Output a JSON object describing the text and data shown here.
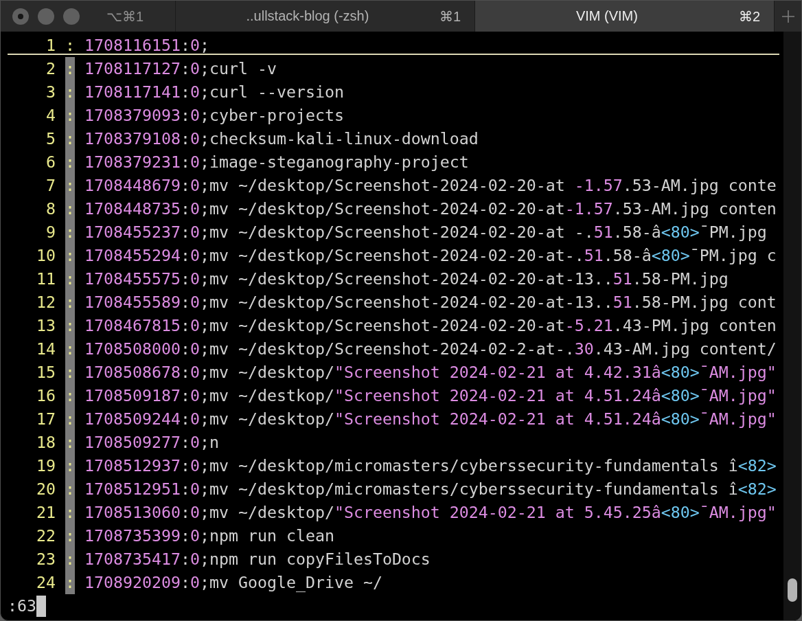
{
  "window": {
    "shortcut": "⌥⌘1"
  },
  "tabs": [
    {
      "title": "..ullstack-blog (-zsh)",
      "shortcut": "⌘1",
      "selected": false
    },
    {
      "title": "VIM (VIM)",
      "shortcut": "⌘2",
      "selected": true
    }
  ],
  "editor": {
    "lines": [
      {
        "number": "1",
        "prefix": ":",
        "highlighted": false,
        "cursorline": true,
        "segments": [
          {
            "kind": "constant",
            "text": "1708116151"
          },
          {
            "kind": "plain",
            "text": ":"
          },
          {
            "kind": "constant",
            "text": "0"
          },
          {
            "kind": "plain",
            "text": ";"
          }
        ]
      },
      {
        "number": "2",
        "prefix": ":",
        "highlighted": true,
        "cursorline": false,
        "segments": [
          {
            "kind": "constant",
            "text": "1708117127"
          },
          {
            "kind": "plain",
            "text": ":"
          },
          {
            "kind": "constant",
            "text": "0"
          },
          {
            "kind": "plain",
            "text": ";curl -v"
          }
        ]
      },
      {
        "number": "3",
        "prefix": ":",
        "highlighted": true,
        "cursorline": false,
        "segments": [
          {
            "kind": "constant",
            "text": "1708117141"
          },
          {
            "kind": "plain",
            "text": ":"
          },
          {
            "kind": "constant",
            "text": "0"
          },
          {
            "kind": "plain",
            "text": ";curl --version"
          }
        ]
      },
      {
        "number": "4",
        "prefix": ":",
        "highlighted": true,
        "cursorline": false,
        "segments": [
          {
            "kind": "constant",
            "text": "1708379093"
          },
          {
            "kind": "plain",
            "text": ":"
          },
          {
            "kind": "constant",
            "text": "0"
          },
          {
            "kind": "plain",
            "text": ";cyber-projects"
          }
        ]
      },
      {
        "number": "5",
        "prefix": ":",
        "highlighted": true,
        "cursorline": false,
        "segments": [
          {
            "kind": "constant",
            "text": "1708379108"
          },
          {
            "kind": "plain",
            "text": ":"
          },
          {
            "kind": "constant",
            "text": "0"
          },
          {
            "kind": "plain",
            "text": ";checksum-kali-linux-download"
          }
        ]
      },
      {
        "number": "6",
        "prefix": ":",
        "highlighted": true,
        "cursorline": false,
        "segments": [
          {
            "kind": "constant",
            "text": "1708379231"
          },
          {
            "kind": "plain",
            "text": ":"
          },
          {
            "kind": "constant",
            "text": "0"
          },
          {
            "kind": "plain",
            "text": ";image-steganography-project"
          }
        ]
      },
      {
        "number": "7",
        "prefix": ":",
        "highlighted": true,
        "cursorline": false,
        "segments": [
          {
            "kind": "constant",
            "text": "1708448679"
          },
          {
            "kind": "plain",
            "text": ":"
          },
          {
            "kind": "constant",
            "text": "0"
          },
          {
            "kind": "plain",
            "text": ";mv ~/desktop/Screenshot-2024-02-20-at "
          },
          {
            "kind": "constant",
            "text": "-1.57"
          },
          {
            "kind": "plain",
            "text": ".53-AM.jpg conte"
          }
        ]
      },
      {
        "number": "8",
        "prefix": ":",
        "highlighted": true,
        "cursorline": false,
        "segments": [
          {
            "kind": "constant",
            "text": "1708448735"
          },
          {
            "kind": "plain",
            "text": ":"
          },
          {
            "kind": "constant",
            "text": "0"
          },
          {
            "kind": "plain",
            "text": ";mv ~/desktop/Screenshot-2024-02-20-at"
          },
          {
            "kind": "constant",
            "text": "-1.57"
          },
          {
            "kind": "plain",
            "text": ".53-AM.jpg conten"
          }
        ]
      },
      {
        "number": "9",
        "prefix": ":",
        "highlighted": true,
        "cursorline": false,
        "segments": [
          {
            "kind": "constant",
            "text": "1708455237"
          },
          {
            "kind": "plain",
            "text": ":"
          },
          {
            "kind": "constant",
            "text": "0"
          },
          {
            "kind": "plain",
            "text": ";mv ~/desktop/Screenshot-2024-02-20-at -."
          },
          {
            "kind": "constant",
            "text": "51"
          },
          {
            "kind": "plain",
            "text": ".58-â"
          },
          {
            "kind": "special",
            "text": "<80>"
          },
          {
            "kind": "plain",
            "text": "¯PM.jpg"
          }
        ]
      },
      {
        "number": "10",
        "prefix": ":",
        "highlighted": true,
        "cursorline": false,
        "segments": [
          {
            "kind": "constant",
            "text": "1708455294"
          },
          {
            "kind": "plain",
            "text": ":"
          },
          {
            "kind": "constant",
            "text": "0"
          },
          {
            "kind": "plain",
            "text": ";mv ~/destkop/Screenshot-2024-02-20-at-."
          },
          {
            "kind": "constant",
            "text": "51"
          },
          {
            "kind": "plain",
            "text": ".58-â"
          },
          {
            "kind": "special",
            "text": "<80>"
          },
          {
            "kind": "plain",
            "text": "¯PM.jpg c"
          }
        ]
      },
      {
        "number": "11",
        "prefix": ":",
        "highlighted": true,
        "cursorline": false,
        "segments": [
          {
            "kind": "constant",
            "text": "1708455575"
          },
          {
            "kind": "plain",
            "text": ":"
          },
          {
            "kind": "constant",
            "text": "0"
          },
          {
            "kind": "plain",
            "text": ";mv ~/desktop/Screenshot-2024-02-20-at-13.."
          },
          {
            "kind": "constant",
            "text": "51"
          },
          {
            "kind": "plain",
            "text": ".58-PM.jpg"
          }
        ]
      },
      {
        "number": "12",
        "prefix": ":",
        "highlighted": true,
        "cursorline": false,
        "segments": [
          {
            "kind": "constant",
            "text": "1708455589"
          },
          {
            "kind": "plain",
            "text": ":"
          },
          {
            "kind": "constant",
            "text": "0"
          },
          {
            "kind": "plain",
            "text": ";mv ~/desktop/Screenshot-2024-02-20-at-13.."
          },
          {
            "kind": "constant",
            "text": "51"
          },
          {
            "kind": "plain",
            "text": ".58-PM.jpg cont"
          }
        ]
      },
      {
        "number": "13",
        "prefix": ":",
        "highlighted": true,
        "cursorline": false,
        "segments": [
          {
            "kind": "constant",
            "text": "1708467815"
          },
          {
            "kind": "plain",
            "text": ":"
          },
          {
            "kind": "constant",
            "text": "0"
          },
          {
            "kind": "plain",
            "text": ";mv ~/desktop/Screenshot-2024-02-20-at"
          },
          {
            "kind": "constant",
            "text": "-5.21"
          },
          {
            "kind": "plain",
            "text": ".43-PM.jpg conten"
          }
        ]
      },
      {
        "number": "14",
        "prefix": ":",
        "highlighted": true,
        "cursorline": false,
        "segments": [
          {
            "kind": "constant",
            "text": "1708508000"
          },
          {
            "kind": "plain",
            "text": ":"
          },
          {
            "kind": "constant",
            "text": "0"
          },
          {
            "kind": "plain",
            "text": ";mv ~/desktop/Screenshot-2024-02-2-at-."
          },
          {
            "kind": "constant",
            "text": "30"
          },
          {
            "kind": "plain",
            "text": ".43-AM.jpg content/"
          }
        ]
      },
      {
        "number": "15",
        "prefix": ":",
        "highlighted": true,
        "cursorline": false,
        "segments": [
          {
            "kind": "constant",
            "text": "1708508678"
          },
          {
            "kind": "plain",
            "text": ":"
          },
          {
            "kind": "constant",
            "text": "0"
          },
          {
            "kind": "plain",
            "text": ";mv ~/desktop/"
          },
          {
            "kind": "constant",
            "text": "\"Screenshot 2024-02-21 at 4.42.31â"
          },
          {
            "kind": "special",
            "text": "<80>"
          },
          {
            "kind": "constant",
            "text": "¯AM.jpg\""
          }
        ]
      },
      {
        "number": "16",
        "prefix": ":",
        "highlighted": true,
        "cursorline": false,
        "segments": [
          {
            "kind": "constant",
            "text": "1708509187"
          },
          {
            "kind": "plain",
            "text": ":"
          },
          {
            "kind": "constant",
            "text": "0"
          },
          {
            "kind": "plain",
            "text": ";mv ~/destkop/"
          },
          {
            "kind": "constant",
            "text": "\"Screenshot 2024-02-21 at 4.51.24â"
          },
          {
            "kind": "special",
            "text": "<80>"
          },
          {
            "kind": "constant",
            "text": "¯AM.jpg\""
          }
        ]
      },
      {
        "number": "17",
        "prefix": ":",
        "highlighted": true,
        "cursorline": false,
        "segments": [
          {
            "kind": "constant",
            "text": "1708509244"
          },
          {
            "kind": "plain",
            "text": ":"
          },
          {
            "kind": "constant",
            "text": "0"
          },
          {
            "kind": "plain",
            "text": ";mv ~/desktop/"
          },
          {
            "kind": "constant",
            "text": "\"Screenshot 2024-02-21 at 4.51.24â"
          },
          {
            "kind": "special",
            "text": "<80>"
          },
          {
            "kind": "constant",
            "text": "¯AM.jpg\""
          }
        ]
      },
      {
        "number": "18",
        "prefix": ":",
        "highlighted": true,
        "cursorline": false,
        "segments": [
          {
            "kind": "constant",
            "text": "1708509277"
          },
          {
            "kind": "plain",
            "text": ":"
          },
          {
            "kind": "constant",
            "text": "0"
          },
          {
            "kind": "plain",
            "text": ";n"
          }
        ]
      },
      {
        "number": "19",
        "prefix": ":",
        "highlighted": true,
        "cursorline": false,
        "segments": [
          {
            "kind": "constant",
            "text": "1708512937"
          },
          {
            "kind": "plain",
            "text": ":"
          },
          {
            "kind": "constant",
            "text": "0"
          },
          {
            "kind": "plain",
            "text": ";mv ~/desktop/micromasters/cyberssecurity-fundamentals î"
          },
          {
            "kind": "special",
            "text": "<82>"
          }
        ]
      },
      {
        "number": "20",
        "prefix": ":",
        "highlighted": true,
        "cursorline": false,
        "segments": [
          {
            "kind": "constant",
            "text": "1708512951"
          },
          {
            "kind": "plain",
            "text": ":"
          },
          {
            "kind": "constant",
            "text": "0"
          },
          {
            "kind": "plain",
            "text": ";mv ~/desktop/micromasters/cyberssecurity-fundamentals î"
          },
          {
            "kind": "special",
            "text": "<82>"
          }
        ]
      },
      {
        "number": "21",
        "prefix": ":",
        "highlighted": true,
        "cursorline": false,
        "segments": [
          {
            "kind": "constant",
            "text": "1708513060"
          },
          {
            "kind": "plain",
            "text": ":"
          },
          {
            "kind": "constant",
            "text": "0"
          },
          {
            "kind": "plain",
            "text": ";mv ~/desktop/"
          },
          {
            "kind": "constant",
            "text": "\"Screenshot 2024-02-21 at 5.45.25â"
          },
          {
            "kind": "special",
            "text": "<80>"
          },
          {
            "kind": "constant",
            "text": "¯AM.jpg\""
          }
        ]
      },
      {
        "number": "22",
        "prefix": ":",
        "highlighted": true,
        "cursorline": false,
        "segments": [
          {
            "kind": "constant",
            "text": "1708735399"
          },
          {
            "kind": "plain",
            "text": ":"
          },
          {
            "kind": "constant",
            "text": "0"
          },
          {
            "kind": "plain",
            "text": ";npm run clean"
          }
        ]
      },
      {
        "number": "23",
        "prefix": ":",
        "highlighted": true,
        "cursorline": false,
        "segments": [
          {
            "kind": "constant",
            "text": "1708735417"
          },
          {
            "kind": "plain",
            "text": ":"
          },
          {
            "kind": "constant",
            "text": "0"
          },
          {
            "kind": "plain",
            "text": ";npm run copyFilesToDocs"
          }
        ]
      },
      {
        "number": "24",
        "prefix": ":",
        "highlighted": true,
        "cursorline": false,
        "segments": [
          {
            "kind": "constant",
            "text": "1708920209"
          },
          {
            "kind": "plain",
            "text": ":"
          },
          {
            "kind": "constant",
            "text": "0"
          },
          {
            "kind": "plain",
            "text": ";mv Google_Drive ~/"
          }
        ]
      }
    ]
  },
  "command_line": {
    "text": ":63"
  }
}
